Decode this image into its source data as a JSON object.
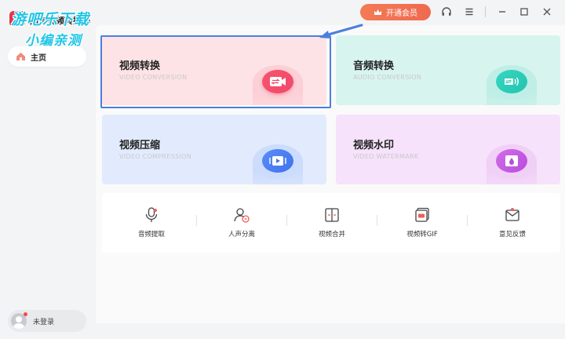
{
  "app": {
    "title": "闪电视频转换器",
    "watermark_line1": "游吧乐下载",
    "watermark_line2": "小编亲测"
  },
  "titlebar": {
    "vip_label": "开通会员",
    "icons": [
      "headset-icon",
      "menu-icon",
      "minimize-icon",
      "maximize-icon",
      "close-icon"
    ]
  },
  "sidebar": {
    "items": [
      {
        "label": "主页",
        "icon": "home-icon"
      }
    ],
    "login_label": "未登录"
  },
  "cards": [
    {
      "title": "视频转换",
      "subtitle": "VIDEO CONVERSION",
      "icon": "video-convert-icon",
      "color": "#f0496a"
    },
    {
      "title": "音频转换",
      "subtitle": "AUDIO CONVERSION",
      "icon": "audio-convert-icon",
      "color": "#21c4b0"
    },
    {
      "title": "视频压缩",
      "subtitle": "VIDEO COMPRESSION",
      "icon": "video-compress-icon",
      "color": "#3f73ef"
    },
    {
      "title": "视频水印",
      "subtitle": "VIDEO WATERMARK",
      "icon": "video-watermark-icon",
      "color": "#b94dde"
    }
  ],
  "tools": [
    {
      "label": "音频提取",
      "icon": "microphone-icon"
    },
    {
      "label": "人声分离",
      "icon": "voice-separate-icon"
    },
    {
      "label": "视频合并",
      "icon": "video-merge-icon"
    },
    {
      "label": "视频转GIF",
      "icon": "gif-icon"
    },
    {
      "label": "意见反馈",
      "icon": "feedback-icon"
    }
  ],
  "colors": {
    "accent": "#ef6a4f",
    "highlight": "#4a7fe0"
  }
}
